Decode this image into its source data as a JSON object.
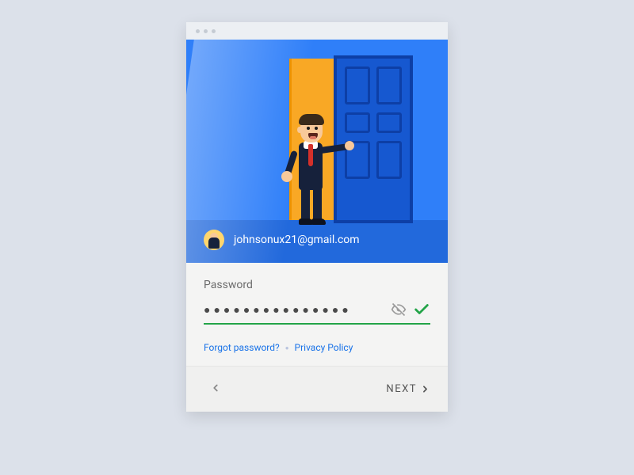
{
  "account": {
    "email": "johnsonux21@gmail.com"
  },
  "form": {
    "password_label": "Password",
    "password_mask": "●●●●●●●●●●●●●●●",
    "forgot_label": "Forgot password?",
    "privacy_label": "Privacy Policy",
    "separator": "●"
  },
  "nav": {
    "next_label": "NEXT"
  },
  "icons": {
    "avatar": "avatar-icon",
    "visibility_off": "eye-off-icon",
    "check": "checkmark-icon",
    "back_chevron": "chevron-left-icon",
    "next_chevron": "chevron-right-icon"
  },
  "colors": {
    "hero_bg": "#2f7ff9",
    "accent_green": "#23a448",
    "link_blue": "#1a73e8"
  }
}
